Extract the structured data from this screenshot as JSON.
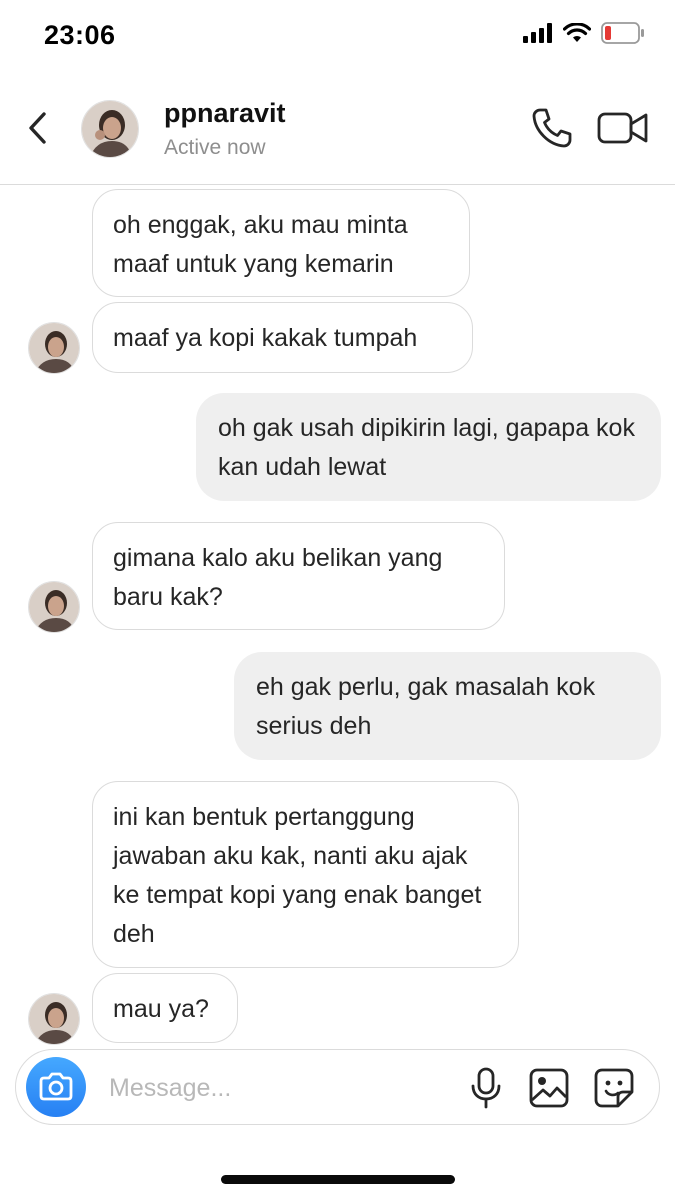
{
  "status_bar": {
    "time": "23:06"
  },
  "header": {
    "username": "ppnaravit",
    "status": "Active now"
  },
  "messages": [
    {
      "side": "received",
      "text": "oh enggak, aku mau minta maaf untuk yang kemarin"
    },
    {
      "side": "received",
      "text": "maaf ya kopi kakak tumpah"
    },
    {
      "side": "sent",
      "text": "oh gak usah dipikirin lagi, gapapa kok kan udah lewat"
    },
    {
      "side": "received",
      "text": "gimana kalo aku belikan yang baru kak?"
    },
    {
      "side": "sent",
      "text": "eh gak perlu, gak masalah kok serius deh"
    },
    {
      "side": "received",
      "text": "ini kan bentuk pertanggung jawaban aku kak, nanti aku ajak ke tempat kopi yang enak banget deh"
    },
    {
      "side": "received",
      "text": "mau ya?"
    }
  ],
  "composer": {
    "placeholder": "Message..."
  },
  "colors": {
    "camera_button": "#3897f0",
    "battery_low": "#e53935"
  },
  "icons": [
    "back-chevron-icon",
    "phone-icon",
    "video-camera-icon",
    "camera-icon",
    "microphone-icon",
    "gallery-icon",
    "sticker-icon"
  ]
}
